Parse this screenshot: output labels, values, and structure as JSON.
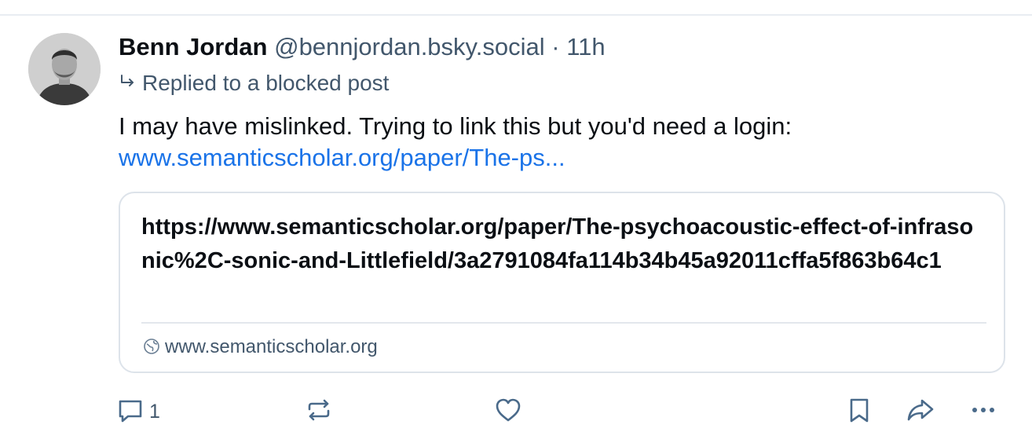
{
  "post": {
    "author_name": "Benn Jordan",
    "author_handle": "@bennjordan.bsky.social",
    "separator": "·",
    "time": "11h",
    "reply_context": "Replied to a blocked post",
    "text": "I may have mislinked. Trying to link this but you'd need a login:",
    "link_text": "www.semanticscholar.org/paper/The-ps..."
  },
  "card": {
    "title": "https://www.semanticscholar.org/paper/The-psychoacoustic-effect-of-infrasonic%2C-sonic-and-Littlefield/3a2791084fa114b34b45a92011cffa5f863b64c1",
    "domain": "www.semanticscholar.org"
  },
  "actions": {
    "reply_count": "1"
  },
  "colors": {
    "link": "#1a73e8",
    "muted": "#42576c",
    "icon": "#4a6a8a",
    "border": "#dde3ea"
  }
}
